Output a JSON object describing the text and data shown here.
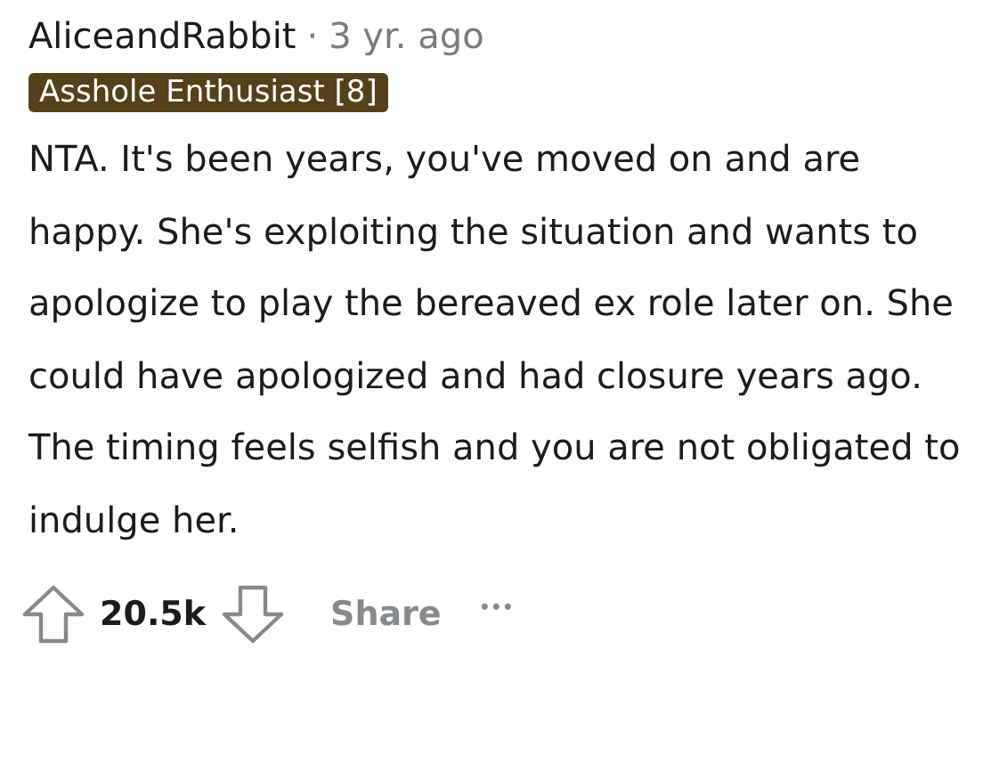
{
  "comment": {
    "author": "AliceandRabbit",
    "separator": "·",
    "age": "3 yr. ago",
    "flair": "Asshole Enthusiast [8]",
    "body": "NTA. It's been years, you've moved on and are happy. She's exploiting the situation and wants to apologize to play the bereaved ex role later on. She could have apologized and had closure years ago. The timing feels selfish and you are not obligated to indulge her.",
    "score": "20.5k",
    "share": "Share",
    "more": "•••"
  }
}
